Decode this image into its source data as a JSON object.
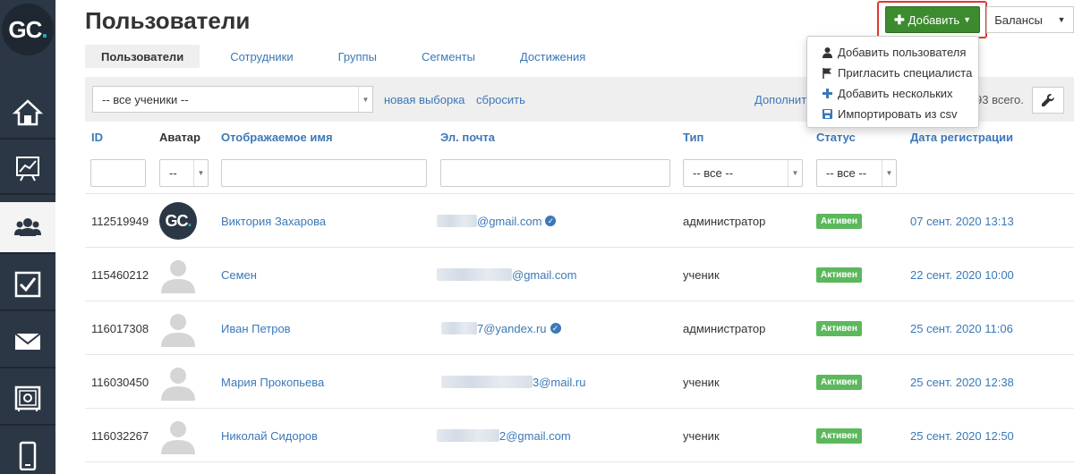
{
  "sidebar": {
    "logo": {
      "letters": "GC",
      "dot": "."
    },
    "items": [
      {
        "icon": "home-icon",
        "active": false
      },
      {
        "icon": "chart-icon",
        "active": false
      },
      {
        "icon": "users-icon",
        "active": true
      },
      {
        "icon": "checkbox-icon",
        "active": false
      },
      {
        "icon": "mail-icon",
        "active": false
      },
      {
        "icon": "safe-icon",
        "active": false
      },
      {
        "icon": "phone-icon",
        "active": false
      }
    ]
  },
  "header": {
    "title": "Пользователи",
    "add_label": "Добавить",
    "balances_label": "Балансы"
  },
  "tabs": [
    {
      "label": "Пользователи",
      "active": true
    },
    {
      "label": "Сотрудники",
      "active": false
    },
    {
      "label": "Группы",
      "active": false
    },
    {
      "label": "Сегменты",
      "active": false
    },
    {
      "label": "Достижения",
      "active": false
    }
  ],
  "filter_bar": {
    "segment_select": "-- все ученики --",
    "new_selection": "новая выборка",
    "reset": "сбросить",
    "additional": "Дополнит",
    "total": "93 всего."
  },
  "table": {
    "columns": {
      "id": "ID",
      "avatar": "Аватар",
      "name": "Отображаемое имя",
      "email": "Эл. почта",
      "type": "Тип",
      "status": "Статус",
      "date": "Дата регистрации"
    },
    "filters": {
      "avatar": "--",
      "type": "-- все --",
      "status": "-- все --"
    },
    "rows": [
      {
        "id": "112519949",
        "avatar": "gc",
        "name": "Виктория Захарова",
        "email_visible": "@gmail.com",
        "verified": true,
        "type": "администратор",
        "status": "Активен",
        "date": "07 сент. 2020 13:13"
      },
      {
        "id": "115460212",
        "avatar": "default",
        "name": "Семен",
        "email_visible": "@gmail.com",
        "verified": false,
        "type": "ученик",
        "status": "Активен",
        "date": "22 сент. 2020 10:00"
      },
      {
        "id": "116017308",
        "avatar": "default",
        "name": "Иван Петров",
        "email_visible": "7@yandex.ru",
        "verified": true,
        "type": "администратор",
        "status": "Активен",
        "date": "25 сент. 2020 11:06"
      },
      {
        "id": "116030450",
        "avatar": "default",
        "name": "Мария Прокопьева",
        "email_visible": "3@mail.ru",
        "verified": false,
        "type": "ученик",
        "status": "Активен",
        "date": "25 сент. 2020 12:38"
      },
      {
        "id": "116032267",
        "avatar": "default",
        "name": "Николай Сидоров",
        "email_visible": "2@gmail.com",
        "verified": false,
        "type": "ученик",
        "status": "Активен",
        "date": "25 сент. 2020 12:50"
      }
    ]
  },
  "dropdown": {
    "items": [
      {
        "icon": "user-icon",
        "label": "Добавить пользователя"
      },
      {
        "icon": "flag-icon",
        "label": "Пригласить специалиста"
      },
      {
        "icon": "plus-icon",
        "label": "Добавить нескольких"
      },
      {
        "icon": "import-icon",
        "label": "Импортировать из csv"
      }
    ]
  },
  "colors": {
    "sidebar": "#2b3744",
    "accent_green": "#3d8b2f",
    "link": "#3b78b8",
    "badge": "#5cb85c",
    "highlight": "#e2372f"
  }
}
